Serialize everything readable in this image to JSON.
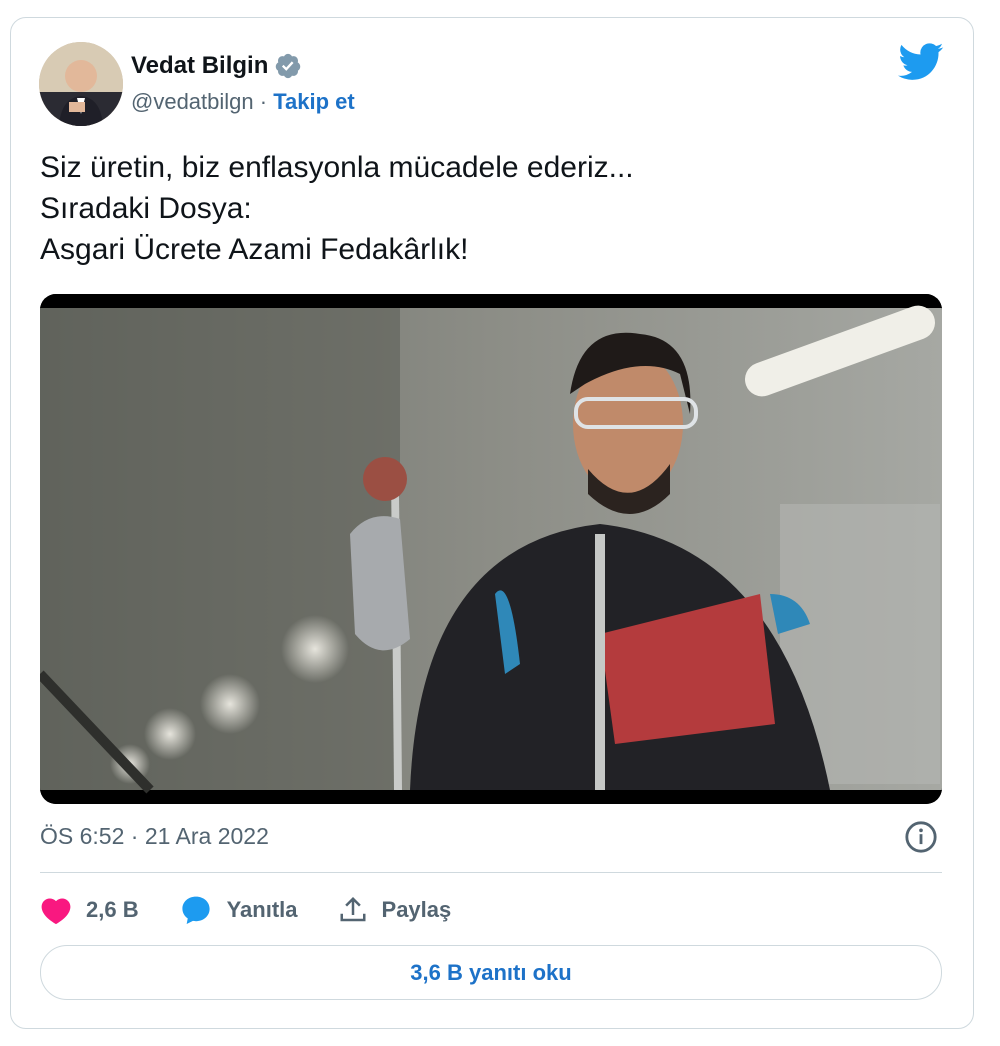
{
  "author": {
    "name": "Vedat Bilgin",
    "handle": "@vedatbilgn",
    "separator": "·",
    "follow_label": "Takip et"
  },
  "tweet": {
    "lines": [
      "Siz üretin, biz enflasyonla mücadele ederiz...",
      "Sıradaki Dosya:",
      "Asgari Ücrete Azami Fedakârlık!"
    ],
    "timestamp": "ÖS 6:52 · 21 Ara 2022"
  },
  "actions": {
    "like_count": "2,6 B",
    "reply_label": "Yanıtla",
    "share_label": "Paylaş"
  },
  "read_replies_label": "3,6 B yanıtı oku",
  "icons": {
    "verified": "verified-badge-icon",
    "logo": "twitter-bird-icon",
    "info": "info-icon",
    "like": "heart-icon",
    "reply": "speech-bubble-icon",
    "share": "upload-icon"
  },
  "colors": {
    "brand": "#1d9bf0",
    "link": "#1d72c8",
    "like": "#f91880",
    "text": "#0f1419",
    "secondary": "#536471",
    "border": "#cfd9de"
  }
}
